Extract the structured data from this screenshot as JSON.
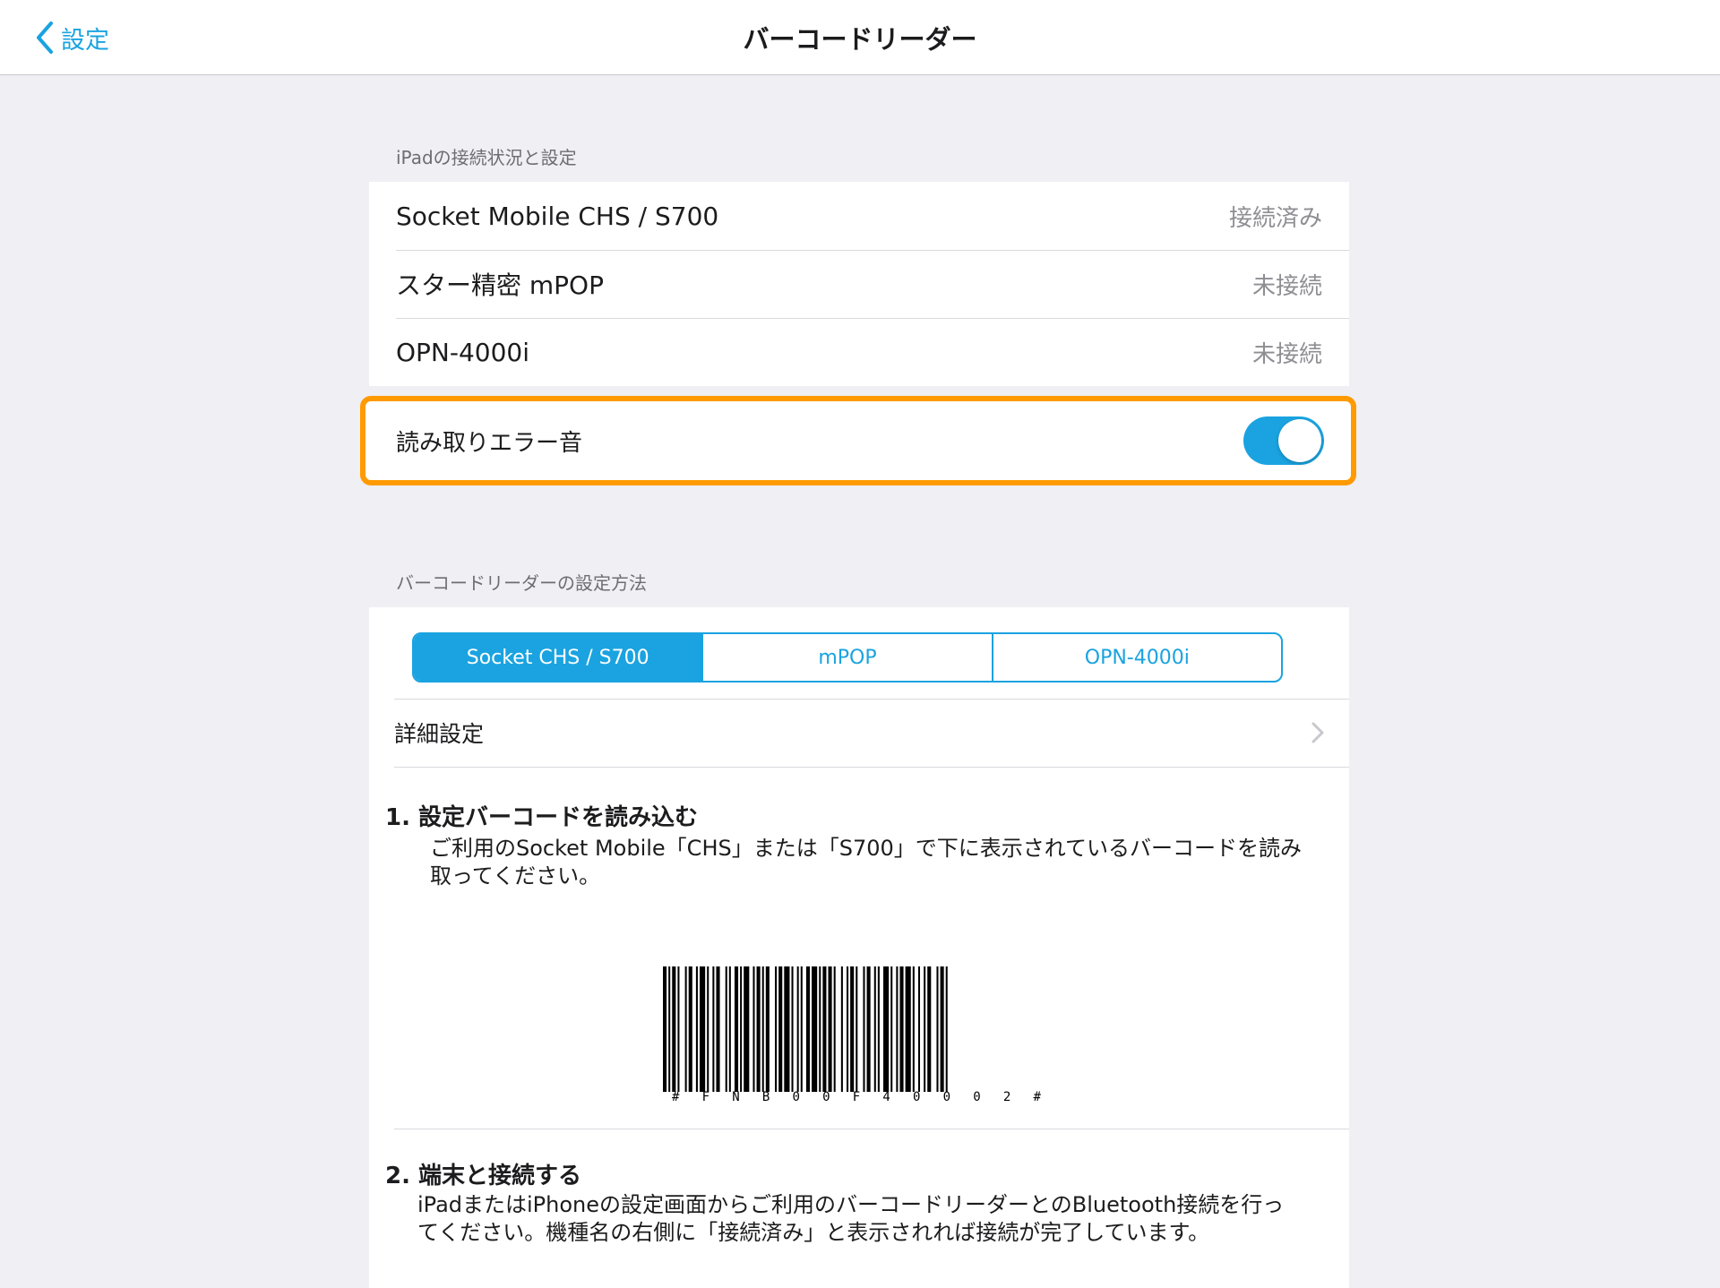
{
  "nav": {
    "back_label": "設定",
    "title": "バーコードリーダー"
  },
  "connection": {
    "header": "iPadの接続状況と設定",
    "devices": [
      {
        "name": "Socket Mobile CHS / S700",
        "status": "接続済み"
      },
      {
        "name": "スター精密 mPOP",
        "status": "未接続"
      },
      {
        "name": "OPN-4000i",
        "status": "未接続"
      }
    ],
    "error_sound_label": "読み取りエラー音",
    "error_sound_on": true
  },
  "setup": {
    "header": "バーコードリーダーの設定方法",
    "segments": [
      "Socket CHS / S700",
      "mPOP",
      "OPN-4000i"
    ],
    "selected_segment": 0,
    "detail_label": "詳細設定",
    "step1_title": "1. 設定バーコードを読み込む",
    "step1_line1": "ご利用のSocket Mobile「CHS」または「S700」で下に表示されているバーコードを読み",
    "step1_line2": "取ってください。",
    "barcode_text": "#FNB00F40002#",
    "step2_title": "2. 端末と接続する",
    "step2_line1": "iPadまたはiPhoneの設定画面からご利用のバーコードリーダーとのBluetooth接続を行っ",
    "step2_line2": "てください。機種名の右側に「接続済み」と表示されれば接続が完了しています。"
  },
  "colors": {
    "accent": "#1aa3e0",
    "highlight": "#ff9a00"
  }
}
